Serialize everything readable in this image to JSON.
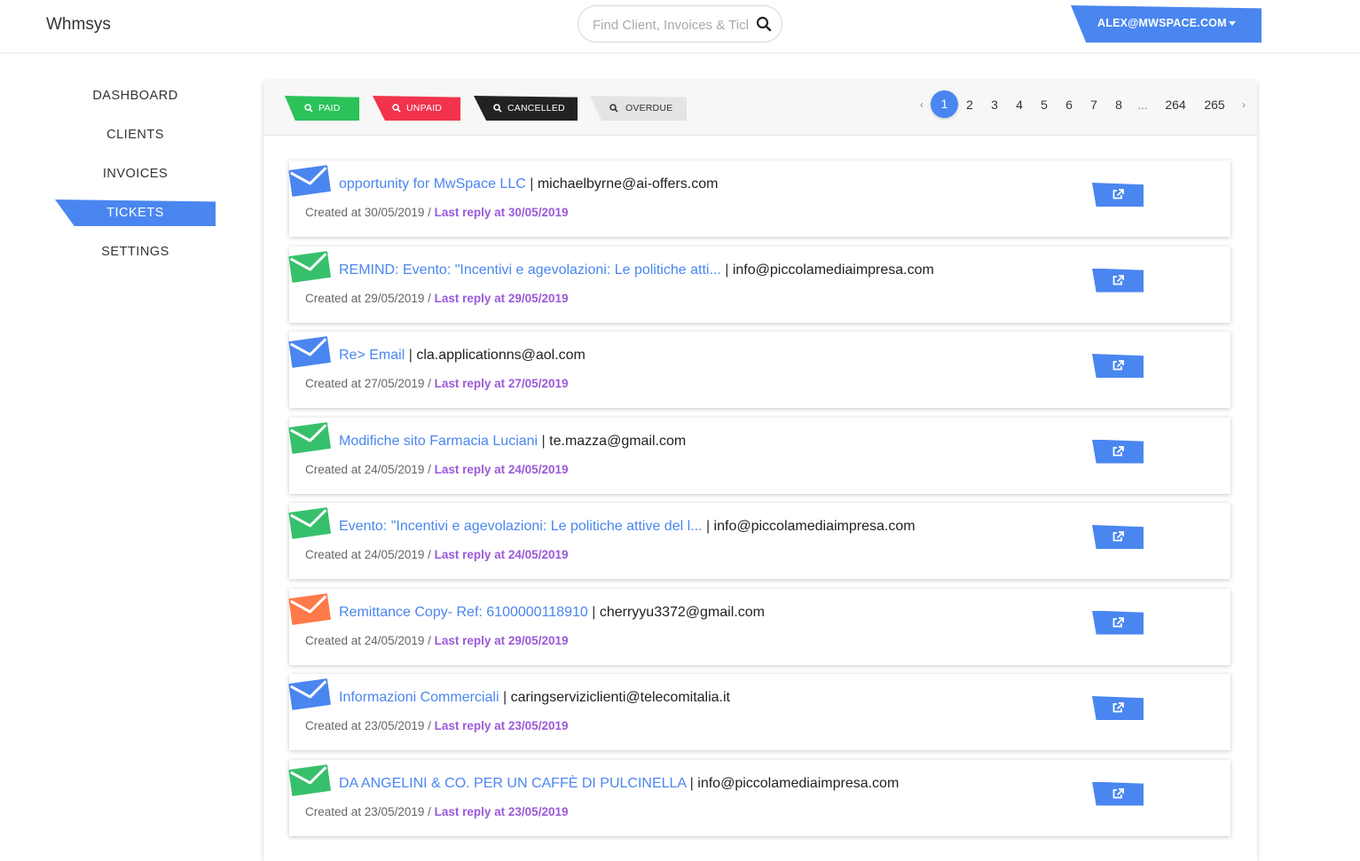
{
  "header": {
    "brand": "Whmsys",
    "search_placeholder": "Find Client, Invoices & Tickets",
    "user_label": "ALEX@MWSPACE.COM"
  },
  "sidebar": {
    "items": [
      {
        "label": "DASHBOARD"
      },
      {
        "label": "CLIENTS"
      },
      {
        "label": "INVOICES"
      },
      {
        "label": "TICKETS",
        "active": true
      },
      {
        "label": "SETTINGS"
      }
    ]
  },
  "filters": {
    "paid": "PAID",
    "unpaid": "UNPAID",
    "cancelled": "CANCELLED",
    "overdue": "OVERDUE"
  },
  "pagination": {
    "prev": "‹",
    "pages": [
      "1",
      "2",
      "3",
      "4",
      "5",
      "6",
      "7",
      "8",
      "...",
      "264",
      "265"
    ],
    "current": "1",
    "next": "›"
  },
  "colors": {
    "blue": "#4a86f0",
    "green": "#37c06c",
    "orange": "#ff7a4a",
    "reply": "#9b59d9"
  },
  "tickets": [
    {
      "subject": "opportunity for MwSpace LLC",
      "email": "michaelbyrne@ai-offers.com",
      "created": "Created at 30/05/2019 /",
      "reply": "Last reply at 30/05/2019",
      "icon": "mail-icon-blue"
    },
    {
      "subject": "REMIND: Evento: \"Incentivi e agevolazioni: Le politiche atti...",
      "email": "info@piccolamediaimpresa.com",
      "created": "Created at 29/05/2019 /",
      "reply": "Last reply at 29/05/2019",
      "icon": "mail-icon-green"
    },
    {
      "subject": "Re> Email",
      "email": "cla.applicationns@aol.com",
      "created": "Created at 27/05/2019 /",
      "reply": "Last reply at 27/05/2019",
      "icon": "mail-icon-blue"
    },
    {
      "subject": "Modifiche sito Farmacia Luciani",
      "email": "te.mazza@gmail.com",
      "created": "Created at 24/05/2019 /",
      "reply": "Last reply at 24/05/2019",
      "icon": "mail-icon-green"
    },
    {
      "subject": "Evento: \"Incentivi e agevolazioni: Le politiche attive del l...",
      "email": "info@piccolamediaimpresa.com",
      "created": "Created at 24/05/2019 /",
      "reply": "Last reply at 24/05/2019",
      "icon": "mail-icon-green"
    },
    {
      "subject": "Remittance Copy- Ref: 6100000118910",
      "email": "cherryyu3372@gmail.com",
      "created": "Created at 24/05/2019 /",
      "reply": "Last reply at 29/05/2019",
      "icon": "mail-icon-orange"
    },
    {
      "subject": "Informazioni Commerciali",
      "email": "caringserviziclienti@telecomitalia.it",
      "created": "Created at 23/05/2019 /",
      "reply": "Last reply at 23/05/2019",
      "icon": "mail-icon-blue"
    },
    {
      "subject": "DA ANGELINI & CO. PER UN CAFFÈ DI PULCINELLA",
      "email": "info@piccolamediaimpresa.com",
      "created": "Created at 23/05/2019 /",
      "reply": "Last reply at 23/05/2019",
      "icon": "mail-icon-green"
    }
  ]
}
